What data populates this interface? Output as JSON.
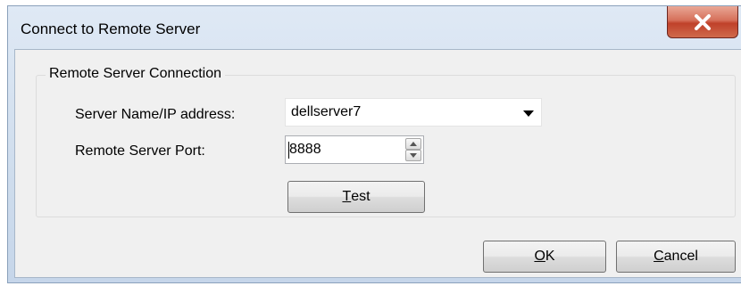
{
  "window": {
    "title": "Connect to Remote Server",
    "close_icon": "close-x-icon",
    "close_color": "#c7432a"
  },
  "group": {
    "title": "Remote Server Connection"
  },
  "server_name": {
    "label": "Server Name/IP address:",
    "value": "dellserver7",
    "dropdown_icon": "chevron-down-icon"
  },
  "port": {
    "label": "Remote Server Port:",
    "value": "8888",
    "spin_up_icon": "spin-up-icon",
    "spin_down_icon": "spin-down-icon"
  },
  "buttons": {
    "test": {
      "mnemonic": "T",
      "rest": "est"
    },
    "ok": {
      "mnemonic": "O",
      "rest": "K"
    },
    "cancel": {
      "mnemonic": "C",
      "rest": "ancel"
    }
  }
}
